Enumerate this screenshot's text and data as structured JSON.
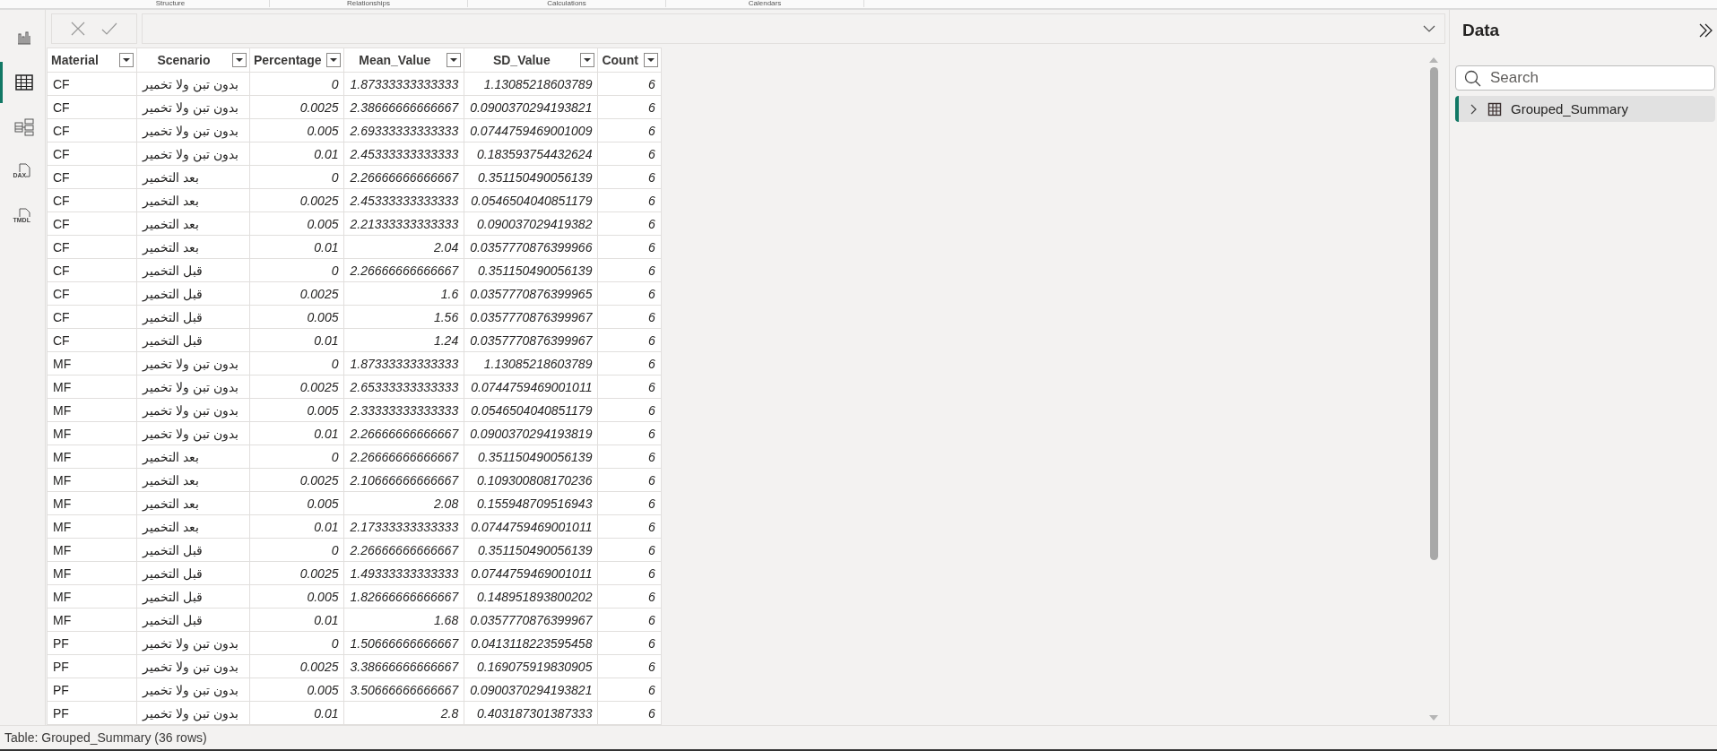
{
  "ribbon_groups": [
    "Structure",
    "Relationships",
    "Calculations",
    "Calendars"
  ],
  "left_rail": [
    {
      "kind": "report",
      "selected": false
    },
    {
      "kind": "table",
      "selected": true
    },
    {
      "kind": "model",
      "selected": false
    },
    {
      "kind": "dax",
      "label": "DAX",
      "selected": false
    },
    {
      "kind": "tmdl",
      "label": "TMDL",
      "selected": false
    }
  ],
  "table": {
    "columns": [
      "Material",
      "Scenario",
      "Percentage",
      "Mean_Value",
      "SD_Value",
      "Count"
    ],
    "rows": [
      [
        "CF",
        "بدون تبن ولا تخمير",
        "0",
        "1.87333333333333",
        "1.13085218603789",
        "6"
      ],
      [
        "CF",
        "بدون تبن ولا تخمير",
        "0.0025",
        "2.38666666666667",
        "0.0900370294193821",
        "6"
      ],
      [
        "CF",
        "بدون تبن ولا تخمير",
        "0.005",
        "2.69333333333333",
        "0.0744759469001009",
        "6"
      ],
      [
        "CF",
        "بدون تبن ولا تخمير",
        "0.01",
        "2.45333333333333",
        "0.183593754432624",
        "6"
      ],
      [
        "CF",
        "بعد التخمير",
        "0",
        "2.26666666666667",
        "0.351150490056139",
        "6"
      ],
      [
        "CF",
        "بعد التخمير",
        "0.0025",
        "2.45333333333333",
        "0.0546504040851179",
        "6"
      ],
      [
        "CF",
        "بعد التخمير",
        "0.005",
        "2.21333333333333",
        "0.090037029419382",
        "6"
      ],
      [
        "CF",
        "بعد التخمير",
        "0.01",
        "2.04",
        "0.0357770876399966",
        "6"
      ],
      [
        "CF",
        "قبل التخمير",
        "0",
        "2.26666666666667",
        "0.351150490056139",
        "6"
      ],
      [
        "CF",
        "قبل التخمير",
        "0.0025",
        "1.6",
        "0.0357770876399965",
        "6"
      ],
      [
        "CF",
        "قبل التخمير",
        "0.005",
        "1.56",
        "0.0357770876399967",
        "6"
      ],
      [
        "CF",
        "قبل التخمير",
        "0.01",
        "1.24",
        "0.0357770876399967",
        "6"
      ],
      [
        "MF",
        "بدون تبن ولا تخمير",
        "0",
        "1.87333333333333",
        "1.13085218603789",
        "6"
      ],
      [
        "MF",
        "بدون تبن ولا تخمير",
        "0.0025",
        "2.65333333333333",
        "0.0744759469001011",
        "6"
      ],
      [
        "MF",
        "بدون تبن ولا تخمير",
        "0.005",
        "2.33333333333333",
        "0.0546504040851179",
        "6"
      ],
      [
        "MF",
        "بدون تبن ولا تخمير",
        "0.01",
        "2.26666666666667",
        "0.0900370294193819",
        "6"
      ],
      [
        "MF",
        "بعد التخمير",
        "0",
        "2.26666666666667",
        "0.351150490056139",
        "6"
      ],
      [
        "MF",
        "بعد التخمير",
        "0.0025",
        "2.10666666666667",
        "0.109300808170236",
        "6"
      ],
      [
        "MF",
        "بعد التخمير",
        "0.005",
        "2.08",
        "0.155948709516943",
        "6"
      ],
      [
        "MF",
        "بعد التخمير",
        "0.01",
        "2.17333333333333",
        "0.0744759469001011",
        "6"
      ],
      [
        "MF",
        "قبل التخمير",
        "0",
        "2.26666666666667",
        "0.351150490056139",
        "6"
      ],
      [
        "MF",
        "قبل التخمير",
        "0.0025",
        "1.49333333333333",
        "0.0744759469001011",
        "6"
      ],
      [
        "MF",
        "قبل التخمير",
        "0.005",
        "1.82666666666667",
        "0.148951893800202",
        "6"
      ],
      [
        "MF",
        "قبل التخمير",
        "0.01",
        "1.68",
        "0.0357770876399967",
        "6"
      ],
      [
        "PF",
        "بدون تبن ولا تخمير",
        "0",
        "1.50666666666667",
        "0.0413118223595458",
        "6"
      ],
      [
        "PF",
        "بدون تبن ولا تخمير",
        "0.0025",
        "3.38666666666667",
        "0.169075919830905",
        "6"
      ],
      [
        "PF",
        "بدون تبن ولا تخمير",
        "0.005",
        "3.50666666666667",
        "0.0900370294193821",
        "6"
      ],
      [
        "PF",
        "بدون تبن ولا تخمير",
        "0.01",
        "2.8",
        "0.403187301387333",
        "6"
      ]
    ]
  },
  "data_pane": {
    "title": "Data",
    "search": {
      "placeholder": "Search"
    },
    "items": [
      {
        "label": "Grouped_Summary",
        "selected": true,
        "expanded": false
      }
    ]
  },
  "status_bar": "Table: Grouped_Summary (36 rows)"
}
